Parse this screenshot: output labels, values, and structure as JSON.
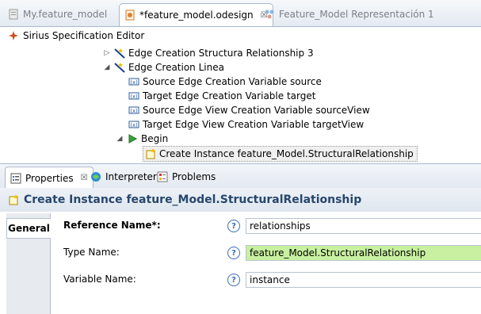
{
  "editor_tabs": [
    {
      "label": "My.feature_model",
      "icon": "model-file-icon"
    },
    {
      "label": "*feature_model.odesign",
      "icon": "odesign-file-icon"
    },
    {
      "label": "Feature_Model Representación 1",
      "icon": "diagram-icon"
    }
  ],
  "editor_header": {
    "title": "Sirius Specification Editor"
  },
  "tree": [
    {
      "label": "Edge Creation Structura Relationship 3",
      "icon": "edge-creation-icon",
      "expanded": false
    },
    {
      "label": "Edge Creation Linea",
      "icon": "edge-creation-icon",
      "expanded": true
    },
    {
      "label": "Source Edge Creation Variable source",
      "icon": "variable-icon"
    },
    {
      "label": "Target Edge Creation Variable target",
      "icon": "variable-icon"
    },
    {
      "label": "Source Edge View Creation Variable sourceView",
      "icon": "variable-icon"
    },
    {
      "label": "Target Edge View Creation Variable targetView",
      "icon": "variable-icon"
    },
    {
      "label": "Begin",
      "icon": "begin-arrow-icon",
      "expanded": true
    },
    {
      "label": "Create Instance feature_Model.StructuralRelationship",
      "icon": "create-instance-icon",
      "selected": true
    }
  ],
  "view_tabs": [
    {
      "label": "Properties",
      "icon": "properties-icon"
    },
    {
      "label": "Interpreter",
      "icon": "interpreter-icon"
    },
    {
      "label": "Problems",
      "icon": "problems-icon"
    }
  ],
  "properties": {
    "title": "Create Instance feature_Model.StructuralRelationship",
    "side_tab": "General",
    "fields": [
      {
        "label": "Reference Name*:",
        "value": "relationships"
      },
      {
        "label": "Type Name:",
        "value": "feature_Model.StructuralRelationship"
      },
      {
        "label": "Variable Name:",
        "value": "instance"
      }
    ]
  },
  "colors": {
    "title_text": "#26476d",
    "type_field_bg": "#c8f0a0",
    "tab_border": "#a9b8cc"
  }
}
